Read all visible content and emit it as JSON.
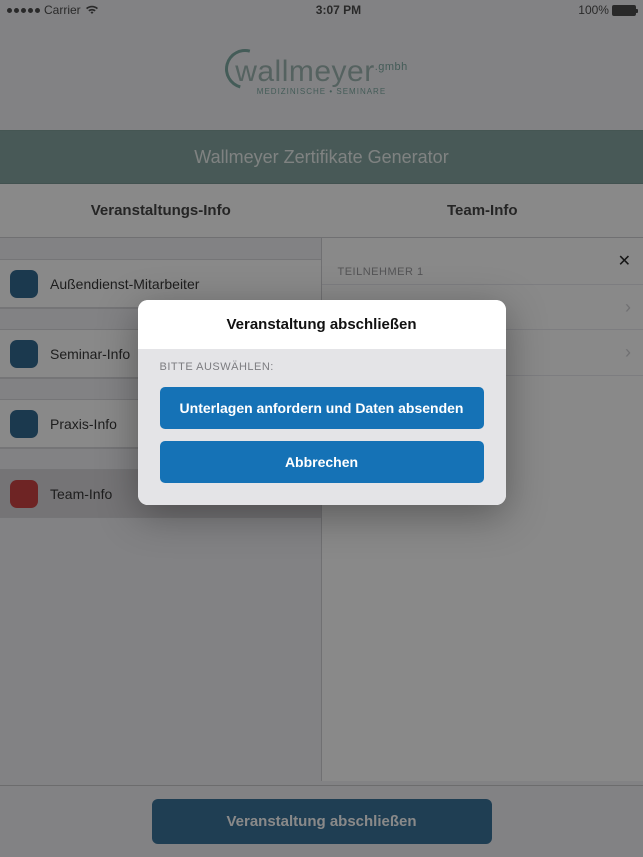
{
  "statusBar": {
    "carrier": "Carrier",
    "time": "3:07 PM",
    "batteryText": "100%"
  },
  "logo": {
    "brand": "wallmeyer",
    "suffix": ".gmbh",
    "subtitle": "MEDIZINISCHE • SEMINARE"
  },
  "titleBar": "Wallmeyer Zertifikate Generator",
  "columns": {
    "left": "Veranstaltungs-Info",
    "right": "Team-Info"
  },
  "leftList": [
    {
      "label": "Außendienst-Mitarbeiter",
      "color": "blue",
      "selected": false
    },
    {
      "label": "Seminar-Info",
      "color": "blue",
      "selected": false
    },
    {
      "label": "Praxis-Info",
      "color": "blue",
      "selected": false
    },
    {
      "label": "Team-Info",
      "color": "red",
      "selected": true
    }
  ],
  "rightList": {
    "sectionLabel": "TEILNEHMER 1",
    "rows": [
      {
        "label": ""
      },
      {
        "label": ""
      }
    ]
  },
  "bottomButton": "Veranstaltung abschließen",
  "dialog": {
    "title": "Veranstaltung abschließen",
    "prompt": "BITTE AUSWÄHLEN:",
    "primary": "Unterlagen anfordern und Daten absenden",
    "cancel": "Abbrechen"
  }
}
